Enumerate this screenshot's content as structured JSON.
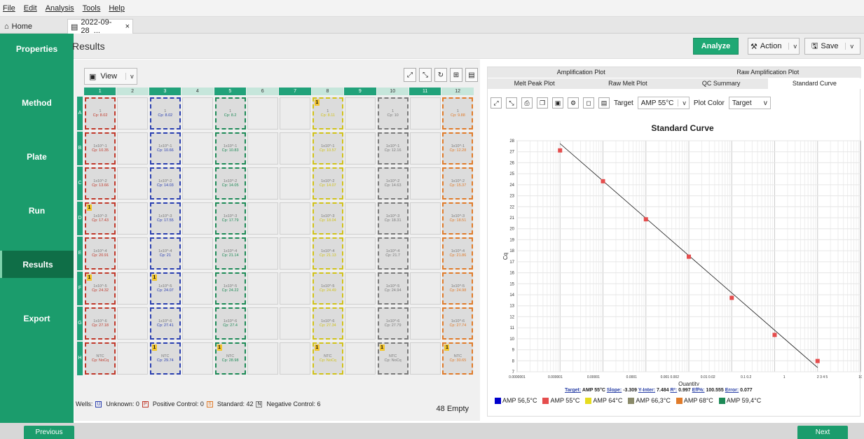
{
  "menu": [
    "File",
    "Edit",
    "Analysis",
    "Tools",
    "Help"
  ],
  "tabs": {
    "home": "Home",
    "file": "2022-09-28_..."
  },
  "sidebar": [
    "Properties",
    "Method",
    "Plate",
    "Run",
    "Results",
    "Export"
  ],
  "header": {
    "title": "Results",
    "analyze": "Analyze",
    "action": "Action",
    "save": "Save"
  },
  "plate": {
    "view": "View",
    "cols": [
      "1",
      "2",
      "3",
      "4",
      "5",
      "6",
      "7",
      "8",
      "9",
      "10",
      "11",
      "12"
    ],
    "rows": [
      "A",
      "B",
      "C",
      "D",
      "E",
      "F",
      "G",
      "H"
    ],
    "labels": [
      "1",
      "1x10^-1",
      "1x10^-2",
      "1x10^-3",
      "1x10^-4",
      "1x10^-5",
      "1x10^-6",
      "NTC"
    ],
    "wells": {
      "1": [
        "Cp: 8.02",
        "Cp: 10.35",
        "Cp: 13.66",
        "Cp: 17.43",
        "Cp: 20.91",
        "Cp: 24.32",
        "Cp: 27.18",
        "Cp: NoCq"
      ],
      "3": [
        "Cp: 8.02",
        "Cp: 10.66",
        "Cp: 14.03",
        "Cp: 17.55",
        "Cp: 21",
        "Cp: 24.07",
        "Cp: 27.41",
        "Cp: 29.74"
      ],
      "5": [
        "Cp: 8.2",
        "Cp: 10.83",
        "Cp: 14.05",
        "Cp: 17.79",
        "Cp: 21.14",
        "Cp: 24.22",
        "Cp: 27.4",
        "Cp: 28.98"
      ],
      "8": [
        "Cp: 8.11",
        "Cp: 10.57",
        "Cp: 14.07",
        "Cp: 18.04",
        "Cp: 21.13",
        "Cp: 24.49",
        "Cp: 27.34",
        "Cp: NoCq"
      ],
      "10": [
        "Cp: 10",
        "Cp: 12.16",
        "Cp: 14.63",
        "Cp: 18.31",
        "Cp: 21.7",
        "Cp: 24.94",
        "Cp: 27.79",
        "Cp: NoCq"
      ],
      "12": [
        "Cp: 9.88",
        "Cp: 12.28",
        "Cp: 15.37",
        "Cp: 18.51",
        "Cp: 21.86",
        "Cp: 24.98",
        "Cp: 27.74",
        "Cp: 30.65"
      ]
    },
    "colors": {
      "1": "#c0392b",
      "3": "#2a3fb0",
      "5": "#1e8a57",
      "8": "#d1c21a",
      "10": "#7a7a7a",
      "12": "#e07b2a"
    },
    "flags": [
      "A8",
      "D1",
      "F1",
      "F3",
      "H3",
      "H5",
      "H8",
      "H10",
      "H12"
    ],
    "well_legend": {
      "unknown": "Unknown: 0",
      "positive": "Positive Control: 0",
      "standard": "Standard: 42",
      "negative": "Negative Control: 6",
      "wells": "Wells:"
    },
    "empty": "48 Empty"
  },
  "right": {
    "tabs1": [
      "Amplification Plot",
      "Raw Amplification Plot"
    ],
    "tabs2": [
      "Melt Peak Plot",
      "Raw Melt Plot",
      "QC Summary",
      "Standard Curve"
    ],
    "target_label": "Target",
    "target_value": "AMP 55°C",
    "plot_color_label": "Plot Color",
    "plot_color_value": "Target"
  },
  "chart_data": {
    "type": "scatter",
    "title": "Standard Curve",
    "xlabel": "Quantity",
    "ylabel": "Cq",
    "x": [
      1e-06,
      1e-05,
      0.0001,
      0.001,
      0.01,
      0.1,
      1
    ],
    "y": [
      27.12,
      24.32,
      20.86,
      17.46,
      13.72,
      10.35,
      7.98
    ],
    "ylim": [
      7,
      28
    ],
    "xticks": [
      "0.0000001",
      "0.000001",
      "0.00001",
      "0.0001",
      "0.001 0.002",
      "0.01 0.02",
      "0.1 0.2",
      "1",
      "2 3 4 5",
      "10"
    ],
    "yticks": [
      "7",
      "8",
      "9",
      "10",
      "11",
      "12",
      "13",
      "14",
      "15",
      "16",
      "17",
      "18",
      "19",
      "20",
      "21",
      "22",
      "23",
      "24",
      "25",
      "26",
      "27",
      "28"
    ]
  },
  "stats": {
    "target": "Target:",
    "target_v": "AMP 55°C",
    "slope": "Slope:",
    "slope_v": "-3.309",
    "yint": "Y-Inter:",
    "yint_v": "7.484",
    "r2": "R²:",
    "r2_v": "0.997",
    "eff": "Eff%:",
    "eff_v": "100.555",
    "err": "Error:",
    "err_v": "0.077"
  },
  "series_legend": [
    {
      "name": "AMP 56,5°C",
      "color": "#0000cc"
    },
    {
      "name": "AMP 55°C",
      "color": "#e54d4d"
    },
    {
      "name": "AMP 64°C",
      "color": "#e6dc1f"
    },
    {
      "name": "AMP 66,3°C",
      "color": "#8a8a6a"
    },
    {
      "name": "AMP 68°C",
      "color": "#e07b2a"
    },
    {
      "name": "AMP 59,4°C",
      "color": "#1e8a57"
    }
  ],
  "nav": {
    "prev": "Previous",
    "next": "Next"
  }
}
